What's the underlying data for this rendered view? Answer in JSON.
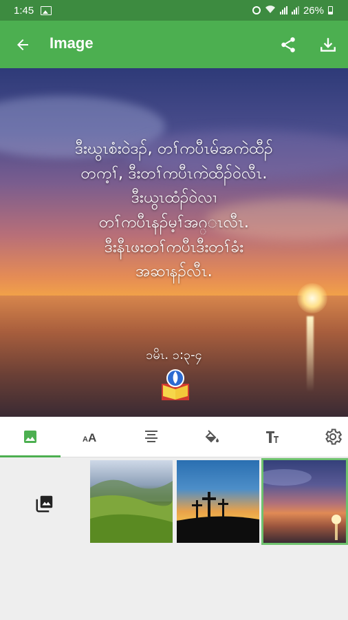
{
  "status_bar": {
    "time": "1:45",
    "battery": "26%"
  },
  "app_bar": {
    "title": "Image"
  },
  "preview": {
    "verse_lines": [
      "ဒီးဃွၤစံးဝဲဒၣ်, တၢ်ကပီၤမ်အကဲထီၣ်",
      "တက့ၢ်, ဒီးတၢ်ကပီၤကဲထီၣ်ဝဲလီၤ.",
      "ဒီးယွၤထံၣ်ဝဲလၢ",
      "တၢ်ကပီၤနၣ်မ့ၢ်အဂ္ၤလီၤ.",
      "ဒီးနီၤဖးတၢ်ကပီၤဒီးတၢ်ခံး",
      "အဆၢနၣ်လီၤ."
    ],
    "reference": "ၥမိၤ. ၁:၃-၄"
  },
  "tabs": [
    {
      "icon": "image-icon",
      "active": true
    },
    {
      "icon": "font-size-icon",
      "active": false
    },
    {
      "icon": "text-align-icon",
      "active": false
    },
    {
      "icon": "paint-bucket-icon",
      "active": false
    },
    {
      "icon": "text-style-icon",
      "active": false
    },
    {
      "icon": "settings-icon",
      "active": false
    }
  ],
  "gallery": {
    "thumbnails": [
      {
        "name": "green-hills",
        "selected": false
      },
      {
        "name": "crosses-sunset",
        "selected": false
      },
      {
        "name": "sea-sunset",
        "selected": true
      }
    ]
  },
  "colors": {
    "status_bar": "#3d8b40",
    "app_bar": "#4caf50",
    "accent": "#4caf50"
  }
}
